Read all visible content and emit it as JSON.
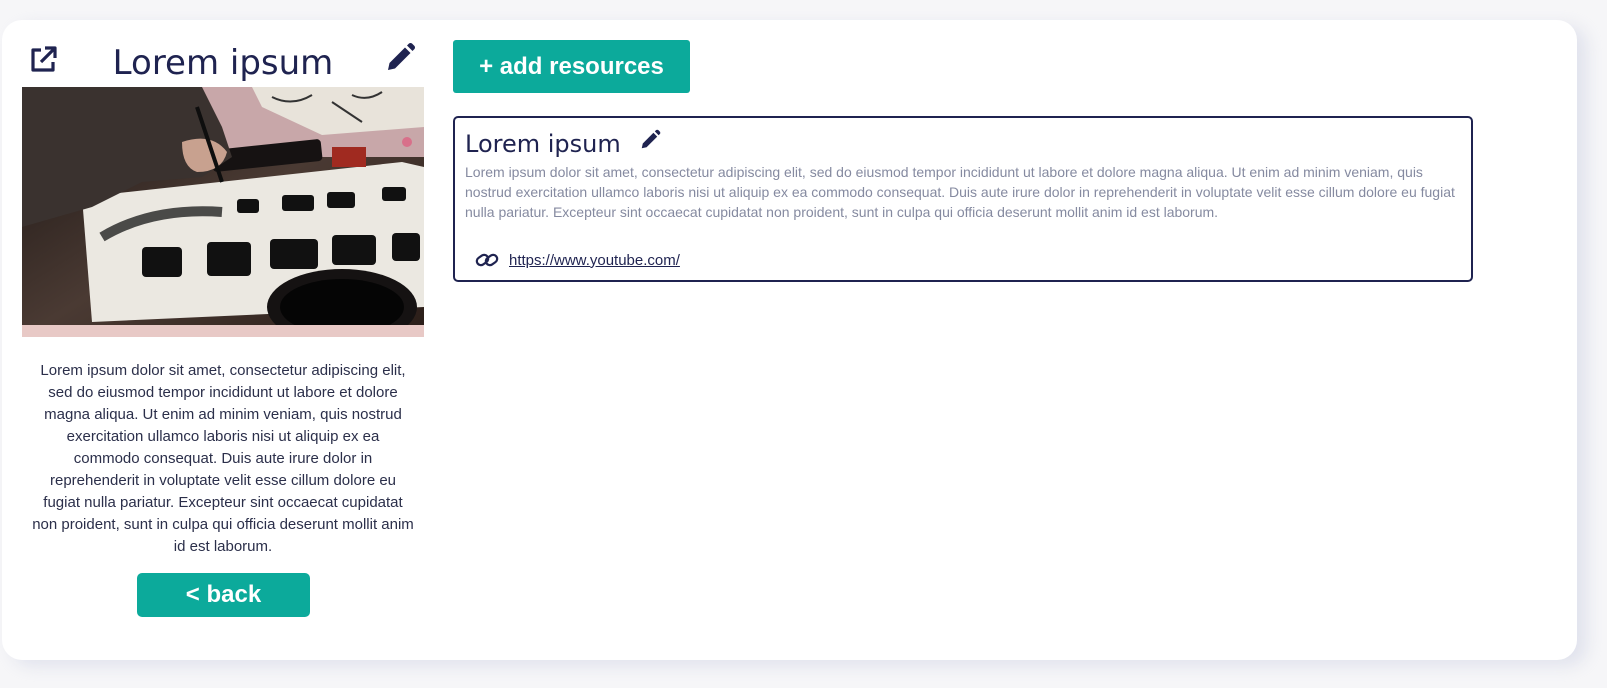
{
  "item": {
    "title": "Lorem ipsum",
    "description": "Lorem ipsum dolor sit amet, consectetur adipiscing elit, sed do eiusmod tempor incididunt ut labore et dolore magna aliqua. Ut enim ad minim veniam, quis nostrud exercitation ullamco laboris nisi ut aliquip ex ea commodo consequat. Duis aute irure dolor in reprehenderit in voluptate velit esse cillum dolore eu fugiat nulla pariatur. Excepteur sint occaecat cupidatat non proident, sunt in culpa qui officia deserunt mollit anim id est laborum.",
    "back_label": "< back",
    "icons": {
      "open": "external-link-icon",
      "edit": "pencil-icon"
    }
  },
  "resources": {
    "add_label": "+ add resources",
    "items": [
      {
        "title": "Lorem ipsum",
        "description": "Lorem ipsum dolor sit amet, consectetur adipiscing elit, sed do eiusmod tempor incididunt ut labore et dolore magna aliqua. Ut enim ad minim veniam, quis nostrud exercitation ullamco laboris nisi ut aliquip ex ea commodo consequat. Duis aute irure dolor in reprehenderit in voluptate velit esse cillum dolore eu fugiat nulla pariatur. Excepteur sint occaecat cupidatat non proident, sunt in culpa qui officia deserunt mollit anim id est laborum.",
        "link": "https://www.youtube.com/",
        "icons": {
          "edit": "pencil-icon",
          "link": "link-icon"
        }
      }
    ]
  },
  "colors": {
    "accent": "#0caa9b",
    "text_dark": "#1f2350",
    "text_muted": "#858aa0",
    "page_bg": "#f6f6f8"
  }
}
